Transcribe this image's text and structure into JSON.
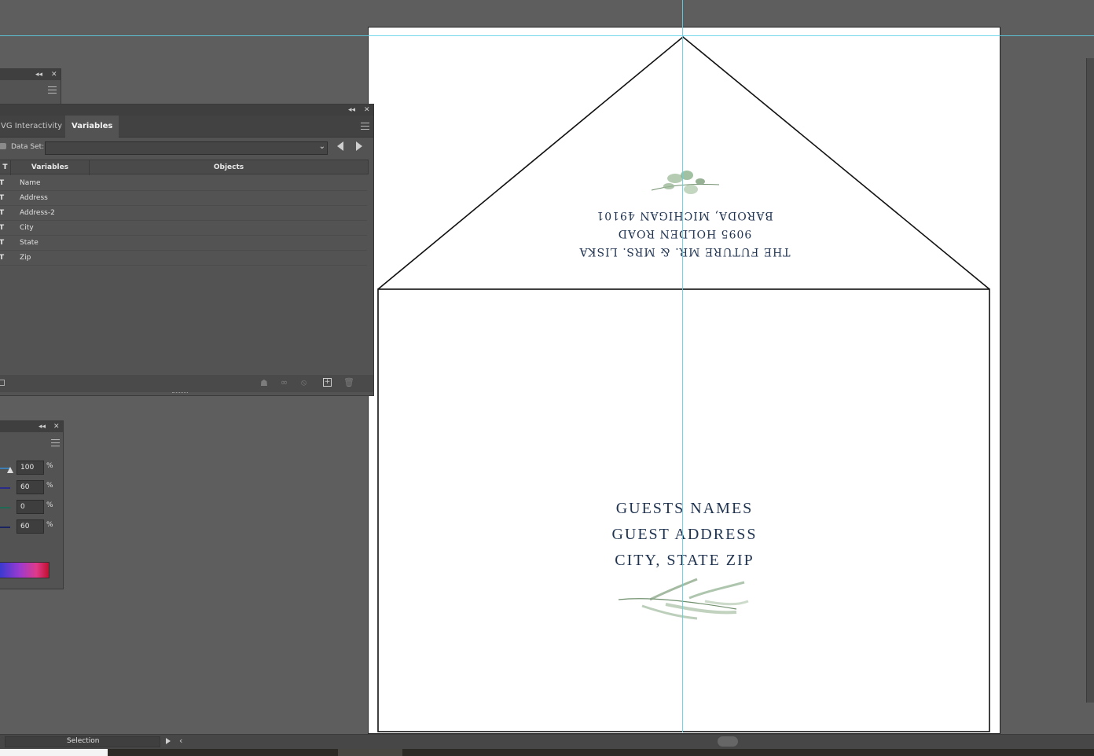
{
  "variables_panel": {
    "tabs": [
      {
        "label": "VG Interactivity"
      },
      {
        "label": "Variables"
      }
    ],
    "data_set_label": "Data Set:",
    "data_set_value": "",
    "columns": [
      "Variables",
      "Objects"
    ],
    "rows": [
      {
        "type": "T",
        "name": "Name"
      },
      {
        "type": "T",
        "name": "Address"
      },
      {
        "type": "T",
        "name": "Address-2"
      },
      {
        "type": "T",
        "name": "City"
      },
      {
        "type": "T",
        "name": "State"
      },
      {
        "type": "T",
        "name": "Zip"
      }
    ]
  },
  "color_panel": {
    "values": [
      "100",
      "60",
      "0",
      "60"
    ],
    "unit": "%"
  },
  "artboard": {
    "return_address": [
      "THE FUTURE MR. & MRS. LISKA",
      "9095 HOLDEN ROAD",
      "BARODA, MICHIGAN 49101"
    ],
    "guest_lines": [
      "GUESTS NAMES",
      "GUEST ADDRESS",
      "CITY, STATE ZIP"
    ]
  },
  "statusbar": {
    "tool": "Selection"
  },
  "colors": {
    "workspace": "#5e5e5e",
    "panel": "#535353",
    "guide": "#5ed2e8",
    "navy_text": "#1f3350",
    "leaf_green": "#7fa17e"
  }
}
